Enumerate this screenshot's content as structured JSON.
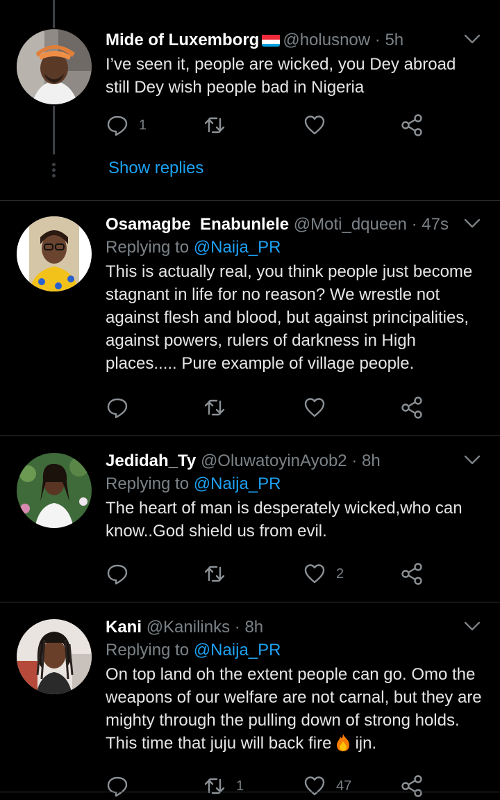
{
  "tweets": [
    {
      "name": "Mide of Luxemborg",
      "handle": "@holusnow",
      "time": "5h",
      "replying_prefix": "",
      "replying_to": "",
      "text": "I’ve seen it, people are wicked, you Dey abroad still Dey wish people bad in Nigeria",
      "reply_count": "1",
      "retweet_count": "",
      "like_count": "",
      "show_replies": "Show replies"
    },
    {
      "name": "Osamagbe  Enabunlele",
      "handle": "@Moti_dqueen",
      "time": "47s",
      "replying_prefix": "Replying to",
      "replying_to": "@Naija_PR",
      "text": "This is actually real, you think people just become stagnant in life for no reason? We wrestle not against flesh and blood, but against principalities, against powers, rulers of darkness in High places..... Pure example of village people.",
      "reply_count": "",
      "retweet_count": "",
      "like_count": ""
    },
    {
      "name": "Jedidah_Ty",
      "handle": "@OluwatoyinAyob2",
      "time": "8h",
      "replying_prefix": "Replying to",
      "replying_to": "@Naija_PR",
      "text": "The heart of man is desperately wicked,who can know..God shield us from evil.",
      "reply_count": "",
      "retweet_count": "",
      "like_count": "2"
    },
    {
      "name": "Kani",
      "handle": "@Kanilinks",
      "time": "8h",
      "replying_prefix": "Replying to",
      "replying_to": "@Naija_PR",
      "text": "On top land oh the extent people can go. Omo the weapons of our welfare are not carnal, but they are mighty through the pulling down of strong holds. This time that juju will back fire",
      "text_after_emoji": "ijn.",
      "reply_count": "",
      "retweet_count": "1",
      "like_count": "47"
    }
  ],
  "separator": "·",
  "colors": {
    "background": "#000000",
    "name": "#ffffff",
    "secondary": "#7b8287",
    "link": "#1da1f2",
    "divider": "#2f3336"
  },
  "icons": [
    "reply-icon",
    "retweet-icon",
    "like-icon",
    "share-icon",
    "chevron-down-icon",
    "luxembourg-flag-icon",
    "fire-emoji-icon"
  ]
}
